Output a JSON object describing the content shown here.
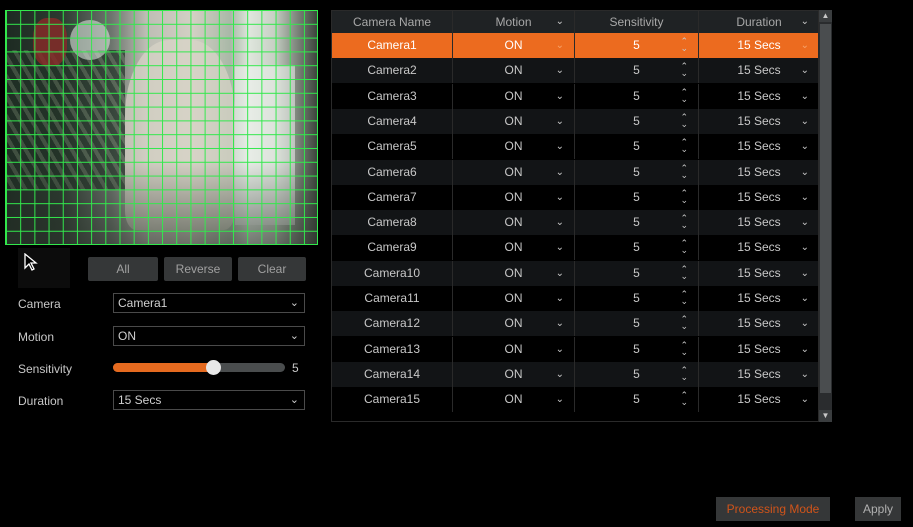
{
  "toolbar": {
    "all": "All",
    "reverse": "Reverse",
    "clear": "Clear"
  },
  "form": {
    "camera_label": "Camera",
    "camera_value": "Camera1",
    "motion_label": "Motion",
    "motion_value": "ON",
    "sensitivity_label": "Sensitivity",
    "sensitivity_value": "5",
    "sensitivity_fraction": 0.58,
    "duration_label": "Duration",
    "duration_value": "15 Secs"
  },
  "table": {
    "headers": [
      "Camera Name",
      "Motion",
      "Sensitivity",
      "Duration"
    ],
    "rows": [
      {
        "name": "Camera1",
        "motion": "ON",
        "sensitivity": "5",
        "duration": "15 Secs"
      },
      {
        "name": "Camera2",
        "motion": "ON",
        "sensitivity": "5",
        "duration": "15 Secs"
      },
      {
        "name": "Camera3",
        "motion": "ON",
        "sensitivity": "5",
        "duration": "15 Secs"
      },
      {
        "name": "Camera4",
        "motion": "ON",
        "sensitivity": "5",
        "duration": "15 Secs"
      },
      {
        "name": "Camera5",
        "motion": "ON",
        "sensitivity": "5",
        "duration": "15 Secs"
      },
      {
        "name": "Camera6",
        "motion": "ON",
        "sensitivity": "5",
        "duration": "15 Secs"
      },
      {
        "name": "Camera7",
        "motion": "ON",
        "sensitivity": "5",
        "duration": "15 Secs"
      },
      {
        "name": "Camera8",
        "motion": "ON",
        "sensitivity": "5",
        "duration": "15 Secs"
      },
      {
        "name": "Camera9",
        "motion": "ON",
        "sensitivity": "5",
        "duration": "15 Secs"
      },
      {
        "name": "Camera10",
        "motion": "ON",
        "sensitivity": "5",
        "duration": "15 Secs"
      },
      {
        "name": "Camera11",
        "motion": "ON",
        "sensitivity": "5",
        "duration": "15 Secs"
      },
      {
        "name": "Camera12",
        "motion": "ON",
        "sensitivity": "5",
        "duration": "15 Secs"
      },
      {
        "name": "Camera13",
        "motion": "ON",
        "sensitivity": "5",
        "duration": "15 Secs"
      },
      {
        "name": "Camera14",
        "motion": "ON",
        "sensitivity": "5",
        "duration": "15 Secs"
      },
      {
        "name": "Camera15",
        "motion": "ON",
        "sensitivity": "5",
        "duration": "15 Secs"
      }
    ],
    "selected_index": 0
  },
  "footer": {
    "processing_mode": "Processing Mode",
    "apply": "Apply"
  },
  "colors": {
    "accent": "#ec6b1f",
    "grid": "#32e84c"
  },
  "icons": {
    "dropdown": "chevron-down-icon",
    "spinner": "spinner-arrows-icon",
    "cursor": "mouse-pointer-icon"
  }
}
